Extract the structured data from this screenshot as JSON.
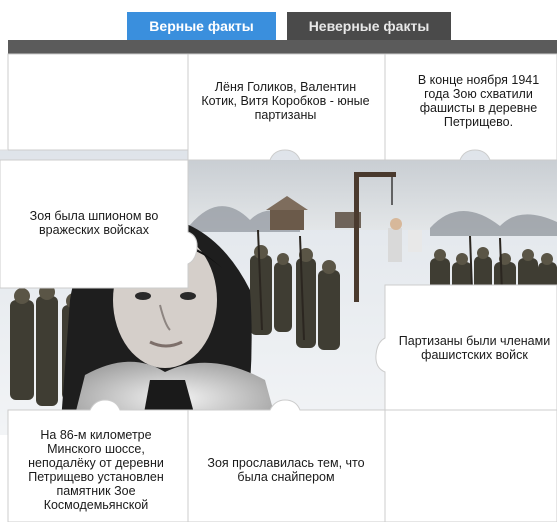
{
  "tabs": {
    "true_label": "Верные факты",
    "false_label": "Неверные факты",
    "active": "true_facts",
    "active_color": "#3a8fdd",
    "inactive_color": "#4a4a4a"
  },
  "cards": {
    "young_partisans": "Лёня Голиков, Валентин Котик, Витя Коробков - юные партизаны",
    "zoya_captured": "В конце ноября 1941 года Зою схватили фашисты в деревне Петрищево.",
    "zoya_spy": "Зоя была шпионом во вражеских войсках",
    "partisans_fascists": "Партизаны были членами фашистских войск",
    "monument": "На 86-м километре Минского шоссе, неподалёку от деревни Петрищево установлен памятник Зое Космодемьянской",
    "zoya_sniper": "Зоя прославилась тем, что была снайпером"
  }
}
